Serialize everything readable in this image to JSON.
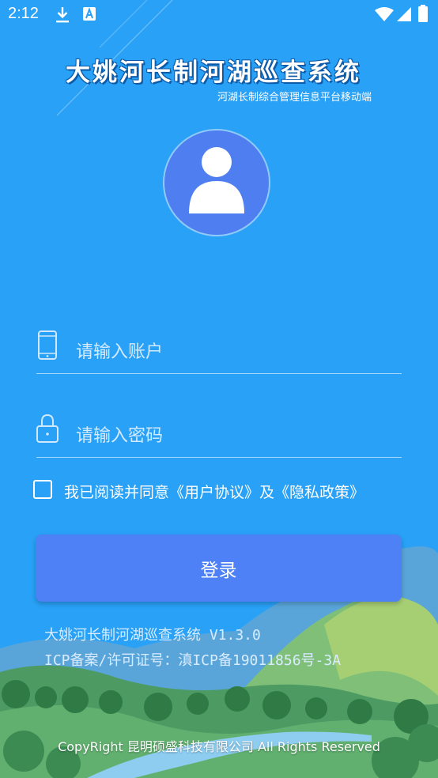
{
  "status_bar": {
    "time": "2:12"
  },
  "header": {
    "title": "大姚河长制河湖巡查系统",
    "subtitle": "河湖长制综合管理信息平台移动端"
  },
  "form": {
    "account_placeholder": "请输入账户",
    "password_placeholder": "请输入密码",
    "agreement_text": "我已阅读并同意《用户协议》及《隐私政策》",
    "agreement_checked": false,
    "login_label": "登录"
  },
  "footer": {
    "version": "大姚河长制河湖巡查系统 V1.3.0",
    "icp": "ICP备案/许可证号：滇ICP备19011856号-3A",
    "copyright": "CopyRight 昆明硕盛科技有限公司 All Rights Reserved"
  },
  "colors": {
    "background": "#28a1f6",
    "avatar_bg": "#4f7ef0",
    "button_bg": "#4e80f6"
  },
  "icons": [
    "download-icon",
    "text-badge-icon",
    "wifi-icon",
    "signal-icon",
    "battery-icon",
    "avatar-person-icon",
    "phone-icon",
    "lock-icon"
  ]
}
